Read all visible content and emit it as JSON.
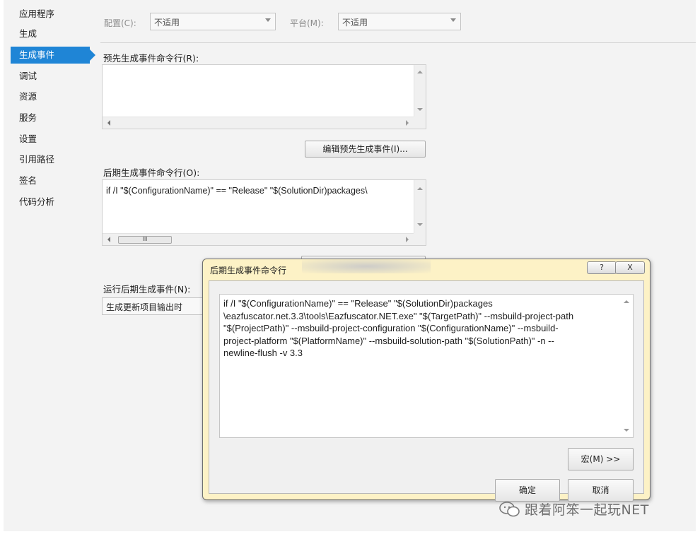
{
  "sidebar": {
    "items": [
      {
        "label": "应用程序"
      },
      {
        "label": "生成"
      },
      {
        "label": "生成事件",
        "active": true
      },
      {
        "label": "调试"
      },
      {
        "label": "资源"
      },
      {
        "label": "服务"
      },
      {
        "label": "设置"
      },
      {
        "label": "引用路径"
      },
      {
        "label": "签名"
      },
      {
        "label": "代码分析"
      }
    ]
  },
  "toolbar": {
    "config_label": "配置(C):",
    "config_value": "不适用",
    "platform_label": "平台(M):",
    "platform_value": "不适用"
  },
  "prebuild": {
    "label": "预先生成事件命令行(R):",
    "value": "",
    "edit_button": "编辑预先生成事件(I)..."
  },
  "postbuild": {
    "label": "后期生成事件命令行(O):",
    "value": "if /I \"$(ConfigurationName)\" == \"Release\" \"$(SolutionDir)packages\\",
    "scroll_thumb": "III"
  },
  "run_postbuild": {
    "label": "运行后期生成事件(N):",
    "value": "生成更新项目输出时"
  },
  "dialog": {
    "title": "后期生成事件命令行",
    "help_button": "?",
    "close_button": "X",
    "text": "if /I \"$(ConfigurationName)\" == \"Release\" \"$(SolutionDir)packages\n\\eazfuscator.net.3.3\\tools\\Eazfuscator.NET.exe\" \"$(TargetPath)\" --msbuild-project-path\n\"$(ProjectPath)\" --msbuild-project-configuration \"$(ConfigurationName)\" --msbuild-\nproject-platform \"$(PlatformName)\" --msbuild-solution-path \"$(SolutionPath)\" -n --\nnewline-flush -v 3.3",
    "macros_button": "宏(M) >>",
    "ok_button": "确定",
    "cancel_button": "取消"
  },
  "watermark": {
    "text": "跟着阿笨一起玩NET"
  },
  "colors": {
    "accent": "#1f85d6",
    "dialog_frame": "#fdf2c6",
    "panel": "#f3f3f3"
  }
}
